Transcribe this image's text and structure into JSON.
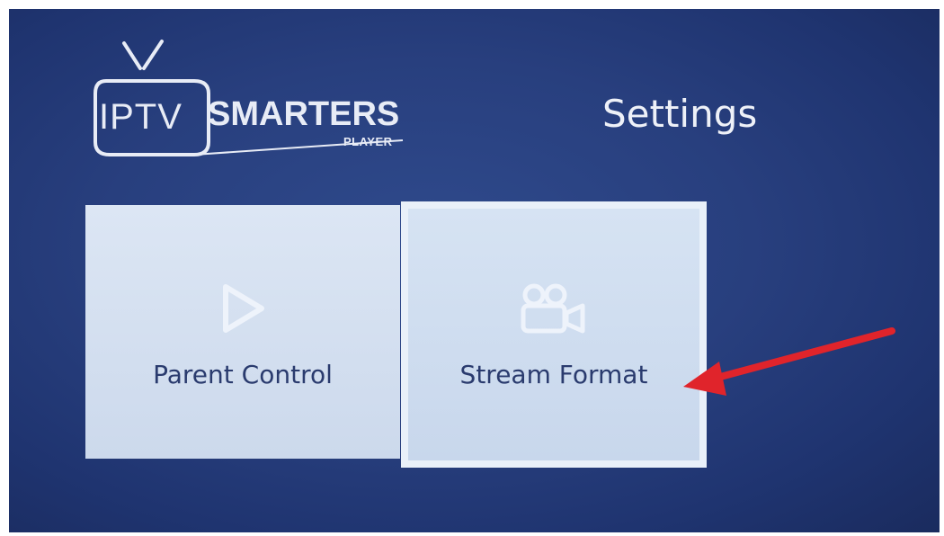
{
  "logo": {
    "brand_left": "IPTV",
    "brand_right": "SMARTERS",
    "brand_sub": "PLAYER"
  },
  "header": {
    "title": "Settings"
  },
  "tiles": [
    {
      "label": "Parent Control",
      "icon": "play-icon"
    },
    {
      "label": "Stream Format",
      "icon": "video-camera-icon"
    }
  ],
  "colors": {
    "background": "#283f7e",
    "tile": "#d3dff0",
    "tile_label": "#2a3b6e",
    "icon": "#eef3fb",
    "arrow": "#e0242b"
  }
}
